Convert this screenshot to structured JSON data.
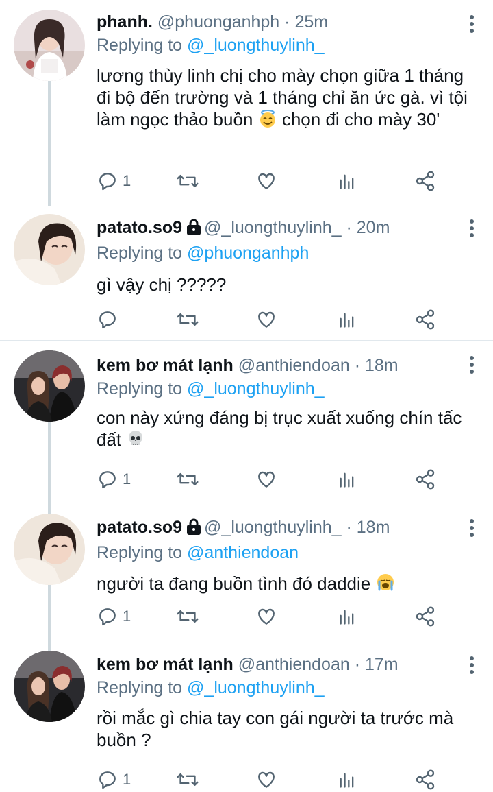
{
  "tweets": [
    {
      "name": "phanh.",
      "handle": "@phuonganhph",
      "time": "25m",
      "replying_prefix": "Replying to ",
      "replying_to": "@_luongthuylinh_",
      "text": "lương thùy linh chị cho mày chọn giữa 1 tháng đi bộ đến trường và 1 tháng chỉ ăn ức gà. vì tội làm ngọc thảo buồn",
      "text_after_emoji": " chọn đi cho mày 30'",
      "emoji": "smiling-face-with-halo",
      "reply_count": "1",
      "protected": false
    },
    {
      "name": "patato.so9",
      "handle": "@_luongthuylinh_",
      "time": "20m",
      "replying_prefix": "Replying to ",
      "replying_to": "@phuonganhph",
      "text": "gì vậy chị ?????",
      "reply_count": "",
      "protected": true
    },
    {
      "name": "kem bơ mát lạnh",
      "handle": "@anthiendoan",
      "time": "18m",
      "replying_prefix": "Replying to ",
      "replying_to": "@_luongthuylinh_",
      "text": "con này xứng đáng bị trục xuất xuống chín tấc đất",
      "emoji": "skull",
      "reply_count": "1",
      "protected": false
    },
    {
      "name": "patato.so9",
      "handle": "@_luongthuylinh_",
      "time": "18m",
      "replying_prefix": "Replying to ",
      "replying_to": "@anthiendoan",
      "text": "người ta đang buồn tình đó daddie",
      "emoji": "loudly-crying-face",
      "reply_count": "1",
      "protected": true
    },
    {
      "name": "kem bơ mát lạnh",
      "handle": "@anthiendoan",
      "time": "17m",
      "replying_prefix": "Replying to ",
      "replying_to": "@_luongthuylinh_",
      "text": "rồi mắc gì chia tay con gái người ta trước mà buồn ?",
      "reply_count": "1",
      "protected": false
    }
  ],
  "separator": " · ",
  "colors": {
    "link": "#1da1f2",
    "secondary": "#5b7083",
    "icon": "#536471",
    "thread_line": "#cfd9de"
  },
  "icons": [
    "reply-icon",
    "retweet-icon",
    "like-icon",
    "analytics-icon",
    "share-icon",
    "more-icon",
    "lock-icon"
  ]
}
